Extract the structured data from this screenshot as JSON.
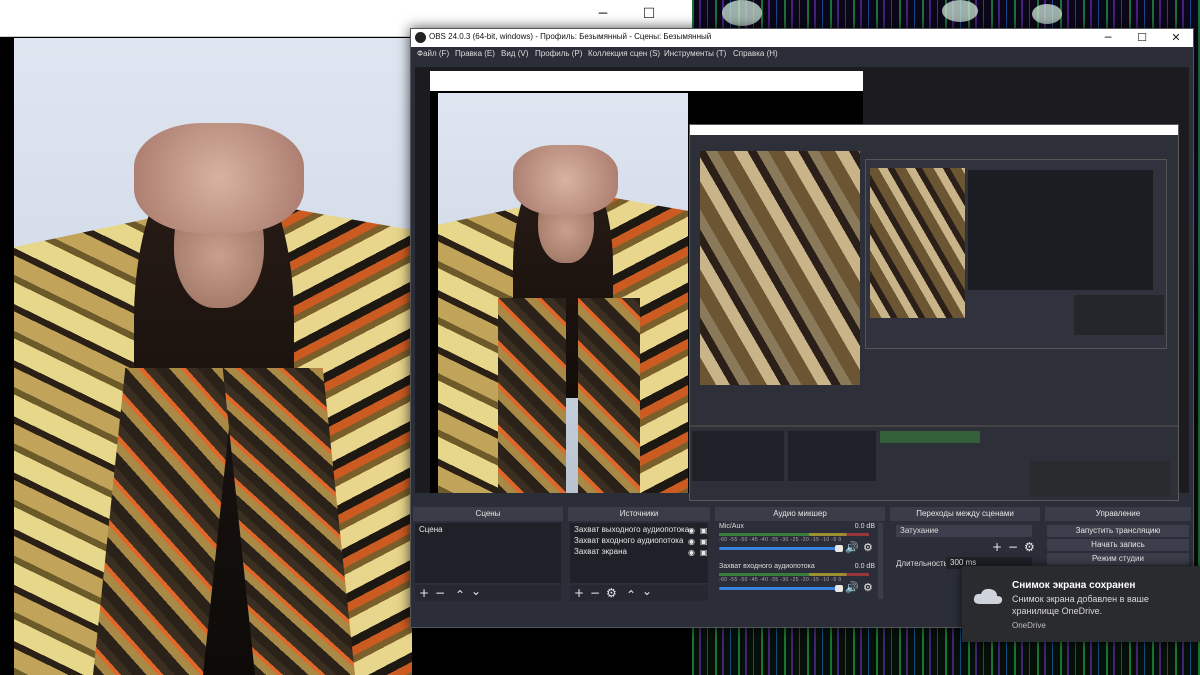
{
  "obs_window": {
    "title": "OBS 24.0.3 (64-bit, windows) - Профиль: Безымянный - Сцены: Безымянный",
    "window_controls": {
      "minimize": "─",
      "maximize": "☐",
      "close": "✕"
    },
    "menu": [
      "Файл (F)",
      "Правка (E)",
      "Вид (V)",
      "Профиль (P)",
      "Коллекция сцен (S)",
      "Инструменты (T)",
      "Справка (H)"
    ]
  },
  "docks": {
    "scenes": {
      "header": "Сцены",
      "items": [
        "Сцена"
      ]
    },
    "sources": {
      "header": "Источники",
      "items": [
        "Захват выходного аудиопотока",
        "Захват входного аудиопотока",
        "Захват экрана"
      ]
    },
    "mixer": {
      "header": "Аудио микшер",
      "channels": [
        {
          "name": "Mic/Aux",
          "db": "0.0 dB"
        },
        {
          "name": "Захват входного аудиопотока",
          "db": "0.0 dB"
        }
      ],
      "tick_labels": "-60 -55 -50 -45 -40 -35 -30 -25 -20 -15 -10 -5 0"
    },
    "transitions": {
      "header": "Переходы между сценами",
      "selected": "Затухание",
      "duration_label": "Длительность",
      "duration_value": "300 ms"
    },
    "controls": {
      "header": "Управление",
      "buttons": [
        "Запустить трансляцию",
        "Начать запись",
        "Режим студии"
      ]
    }
  },
  "toast": {
    "title": "Снимок экрана сохранен",
    "body": "Снимок экрана добавлен в ваше хранилище OneDrive.",
    "source": "OneDrive"
  },
  "icons": {
    "add": "+",
    "remove": "−",
    "up": "⌃",
    "down": "⌄",
    "gear": "⚙",
    "eye": "👁",
    "lock": "🔒",
    "speaker": "🔊"
  },
  "colors": {
    "obs_bg": "#2b2e38",
    "dock_header": "#3a3d48",
    "volume_slider": "#3b82e0"
  }
}
